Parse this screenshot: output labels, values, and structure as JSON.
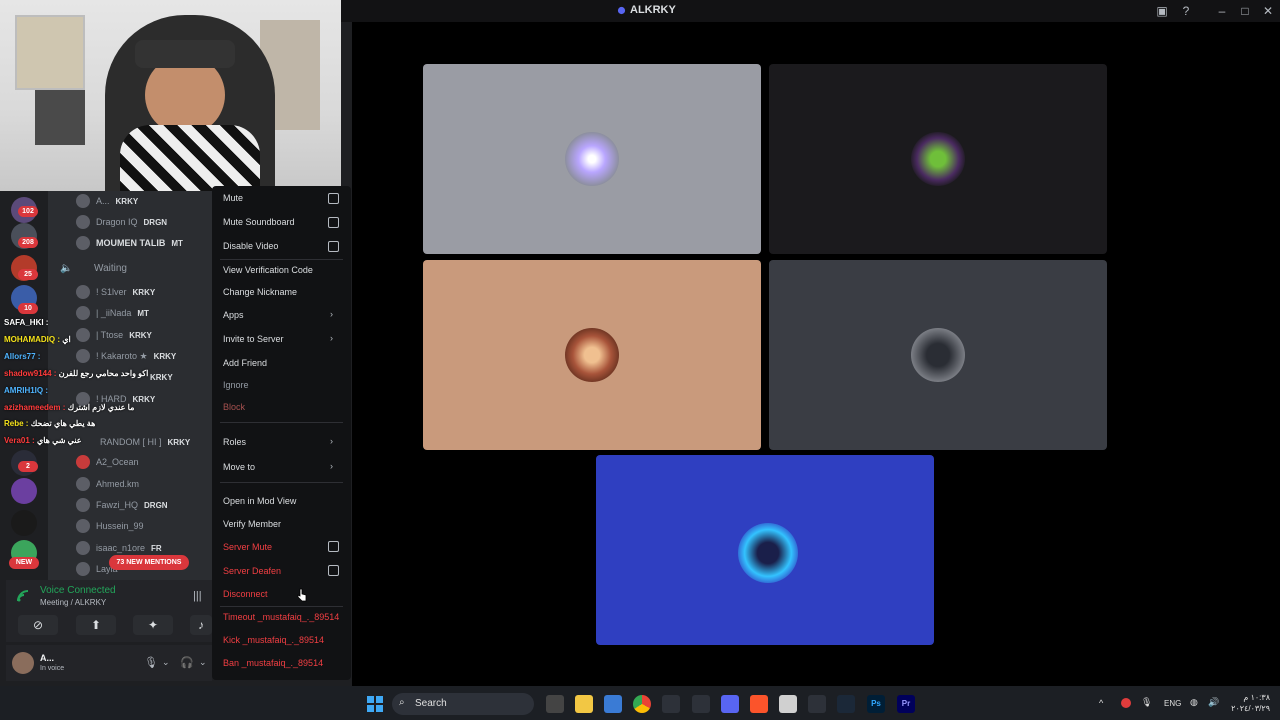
{
  "window": {
    "title": "ALKRKY"
  },
  "server_badges": [
    "102",
    "208",
    "25",
    "10",
    "2"
  ],
  "new_badge": "NEW",
  "members": [
    {
      "name": "A...",
      "tag": "KRKY"
    },
    {
      "name": "Dragon IQ",
      "tag": "DRGN"
    },
    {
      "name": "MOUMEN TALIB",
      "tag": "MT"
    },
    {
      "name": "! S1lver",
      "tag": "KRKY"
    },
    {
      "name": "| _iiNada",
      "tag": "MT"
    },
    {
      "name": "| Ttose",
      "tag": "KRKY"
    },
    {
      "name": "! Kakaroto ★",
      "tag": "KRKY"
    },
    {
      "name": "",
      "tag": "KRKY"
    },
    {
      "name": "! HARD",
      "tag": "KRKY"
    },
    {
      "name": "RANDOM [ HI ]",
      "tag": "KRKY"
    },
    {
      "name": "A2_Ocean",
      "tag": ""
    },
    {
      "name": "Ahmed.km",
      "tag": ""
    },
    {
      "name": "Fawzi_HQ",
      "tag": "DRGN"
    },
    {
      "name": "Hussein_99",
      "tag": ""
    },
    {
      "name": "isaac_n1ore",
      "tag": "FR"
    },
    {
      "name": "Layla",
      "tag": ""
    }
  ],
  "waiting_channel": "Waiting",
  "mentions_pill": "73 NEW MENTIONS",
  "chat": [
    {
      "user": "SAFA_HKI :",
      "msg": "",
      "color": "#ffffff"
    },
    {
      "user": "MOHAMADIQ :",
      "msg": "اي",
      "color": "#f5e21b"
    },
    {
      "user": "Allors77 :",
      "msg": "",
      "color": "#4fb4ff"
    },
    {
      "user": "shadow9144 :",
      "msg": "اكو واحد محامي رجع للفرن",
      "color": "#ff3b3b"
    },
    {
      "user": "AMRIH1IQ :",
      "msg": "",
      "color": "#4fb4ff"
    },
    {
      "user": "azizhameedem :",
      "msg": "ما عندي لازم اشترك",
      "color": "#ff3b3b"
    },
    {
      "user": "Rebe :",
      "msg": "هة يطي هاي تضحك",
      "color": "#f5e21b"
    },
    {
      "user": "Vera01 :",
      "msg": "عني شي هاي",
      "color": "#ff3b3b"
    }
  ],
  "voice": {
    "status": "Voice Connected",
    "channel": "Meeting / ALKRKY"
  },
  "user": {
    "name": "A...",
    "status": "In voice"
  },
  "context_menu": {
    "mute": "Mute",
    "mute_soundboard": "Mute Soundboard",
    "disable_video": "Disable Video",
    "view_verification": "View Verification Code",
    "change_nickname": "Change Nickname",
    "apps": "Apps",
    "invite": "Invite to Server",
    "add_friend": "Add Friend",
    "ignore": "Ignore",
    "block": "Block",
    "roles": "Roles",
    "move_to": "Move to",
    "open_mod_view": "Open in Mod View",
    "verify_member": "Verify Member",
    "server_mute": "Server Mute",
    "server_deafen": "Server Deafen",
    "disconnect": "Disconnect",
    "timeout": "Timeout _mustafaiq_._89514",
    "kick": "Kick _mustafaiq_._89514",
    "ban": "Ban _mustafaiq_._89514"
  },
  "tiles": [
    {
      "bg": "#9a9ca4"
    },
    {
      "bg": "#1b1a1d"
    },
    {
      "bg": "#c99a7c"
    },
    {
      "bg": "#3a3d44"
    },
    {
      "bg": "#2f3fc1"
    }
  ],
  "taskbar": {
    "search": "Search",
    "lang": "ENG",
    "time": "١٠:٣٨ م",
    "date": "٢٠٢٤/٠٣/٢٩"
  }
}
